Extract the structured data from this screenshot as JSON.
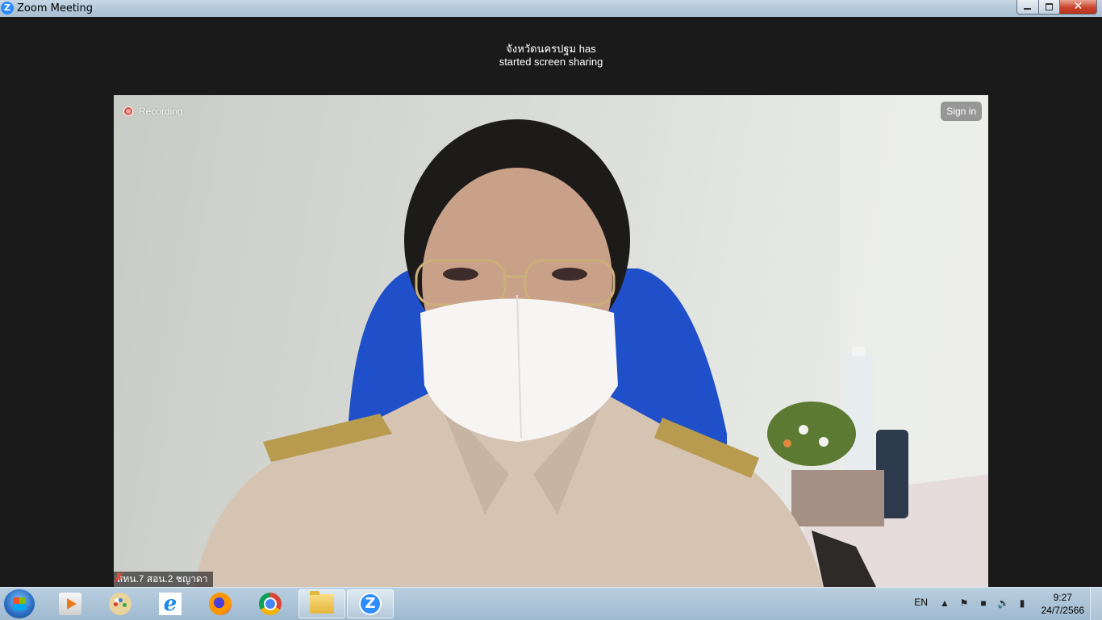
{
  "window": {
    "title": "Zoom Meeting",
    "app_icon_glyph": "Z",
    "close_glyph": "✕"
  },
  "notification": {
    "line1": "จังหวัดนครปฐม has",
    "line2": "started screen sharing"
  },
  "video": {
    "recording_label": "Recording",
    "signin_label": "Sign in",
    "participant_name": "สทน.7 สอน.2 ชญาดา",
    "recording_color": "#e0483b"
  },
  "taskbar": {
    "apps": [
      "windows-media-player-icon",
      "paint-icon",
      "internet-explorer-icon",
      "firefox-icon",
      "chrome-icon",
      "file-explorer-icon",
      "zoom-icon"
    ],
    "ie_glyph": "e",
    "zoom_glyph": "Z",
    "language": "EN",
    "time": "9:27",
    "date": "24/7/2566"
  }
}
